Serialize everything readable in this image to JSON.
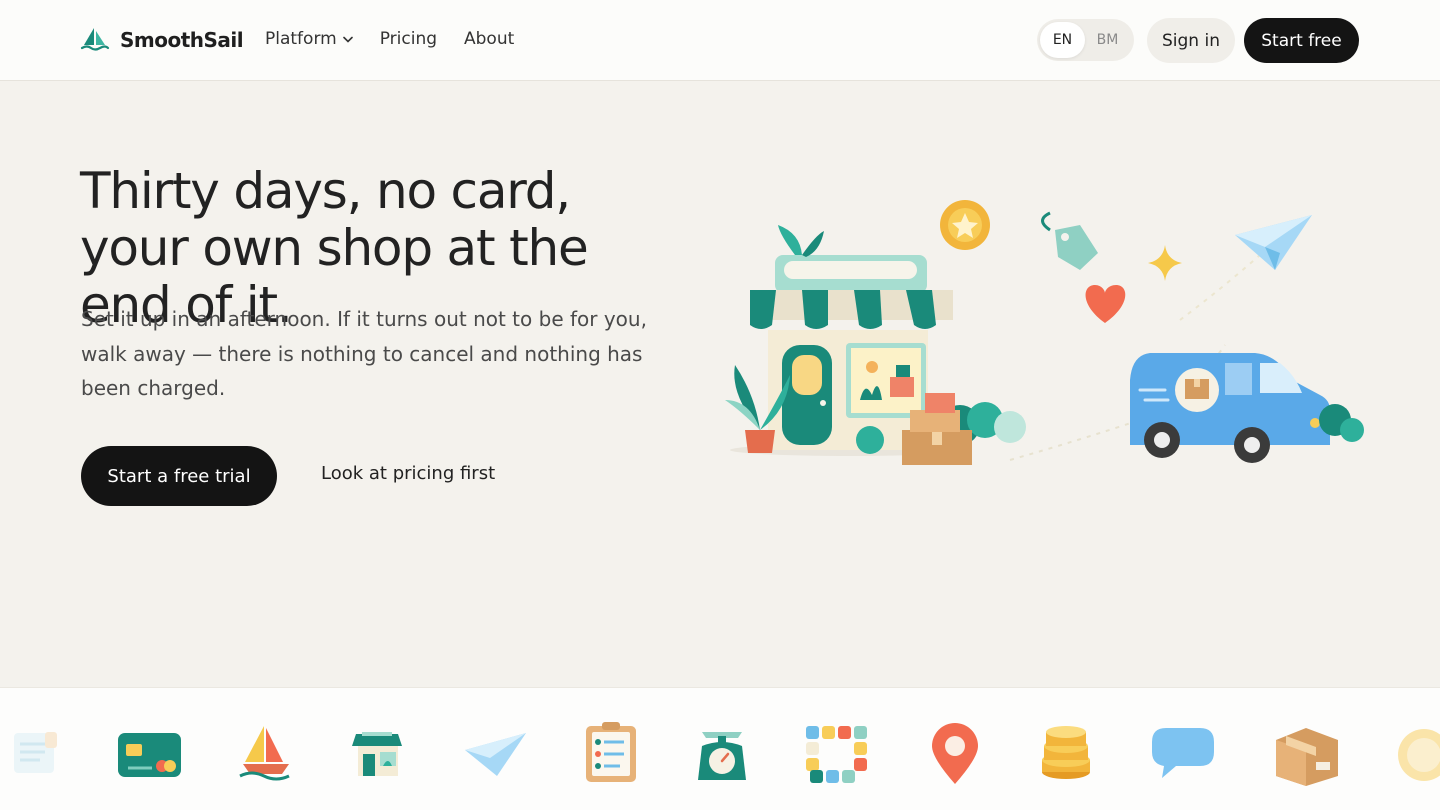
{
  "header": {
    "brand": "SmoothSail",
    "nav": [
      {
        "label": "Platform",
        "has_dropdown": true
      },
      {
        "label": "Pricing"
      },
      {
        "label": "About"
      }
    ],
    "languages": [
      "EN",
      "BM"
    ],
    "active_language": "EN",
    "sign_in": "Sign in",
    "start_free": "Start free"
  },
  "hero": {
    "title": "Thirty days, no card, your own shop at the end of it.",
    "subtitle": "Set it up in an afternoon. If it turns out not to be for you, walk away — there is nothing to cancel and nothing has been charged.",
    "cta_primary": "Start a free trial",
    "cta_secondary": "Look at pricing first"
  },
  "illustration_icons": [
    "storefront-icon",
    "coin-star-icon",
    "price-tag-icon",
    "sparkle-icon",
    "paper-plane-icon",
    "heart-icon",
    "delivery-van-icon",
    "parcel-boxes-icon",
    "plant-icon"
  ],
  "icon_strip": [
    "receipt-icon",
    "credit-card-icon",
    "sailboat-icon",
    "storefront-icon",
    "paper-plane-icon",
    "checklist-icon",
    "scale-icon",
    "color-grid-icon",
    "location-pin-icon",
    "coin-stack-icon",
    "chat-bubble-icon",
    "parcel-icon",
    "coin-icon"
  ],
  "colors": {
    "accent": "#1a8a7a",
    "dark": "#141414",
    "background": "#f4f2ed",
    "header_bg": "#fcfcfa"
  }
}
